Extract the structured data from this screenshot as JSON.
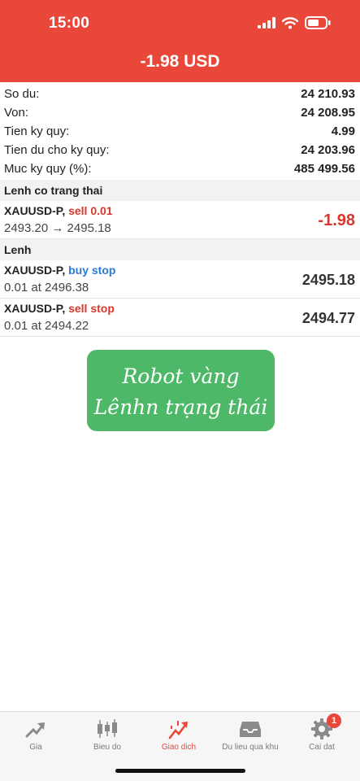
{
  "status_bar": {
    "time": "15:00"
  },
  "header": {
    "profit": "-1.98 USD"
  },
  "summary": [
    {
      "label": "So du:",
      "value": "24 210.93"
    },
    {
      "label": "Von:",
      "value": "24 208.95"
    },
    {
      "label": "Tien ky quy:",
      "value": "4.99"
    },
    {
      "label": "Tien du cho ky quy:",
      "value": "24 203.96"
    },
    {
      "label": "Muc ky quy (%):",
      "value": "485 499.56"
    }
  ],
  "open_positions": {
    "title": "Lenh co trang thai",
    "items": [
      {
        "symbol": "XAUUSD-P,",
        "type": "sell 0.01",
        "prices": "2493.20 → 2495.18",
        "profit": "-1.98"
      }
    ]
  },
  "pending_orders": {
    "title": "Lenh",
    "items": [
      {
        "symbol": "XAUUSD-P,",
        "type": "buy stop",
        "detail": "0.01 at 2496.38",
        "price": "2495.18"
      },
      {
        "symbol": "XAUUSD-P,",
        "type": "sell stop",
        "detail": "0.01 at 2494.22",
        "price": "2494.77"
      }
    ]
  },
  "badge": {
    "line1": "Robot vàng",
    "line2": "Lênhn trạng thái"
  },
  "tabs": [
    {
      "label": "Gia",
      "icon": "trend-arrow-icon"
    },
    {
      "label": "Bieu do",
      "icon": "candlestick-icon"
    },
    {
      "label": "Giao dich",
      "icon": "trading-chart-icon",
      "active": true
    },
    {
      "label": "Du lieu qua khu",
      "icon": "history-inbox-icon"
    },
    {
      "label": "Cai dat",
      "icon": "gear-icon",
      "badge": "1"
    }
  ],
  "colors": {
    "header": "#e8473a",
    "sell": "#d9362d",
    "buy": "#2a7ad4",
    "badge": "#4cb868"
  }
}
